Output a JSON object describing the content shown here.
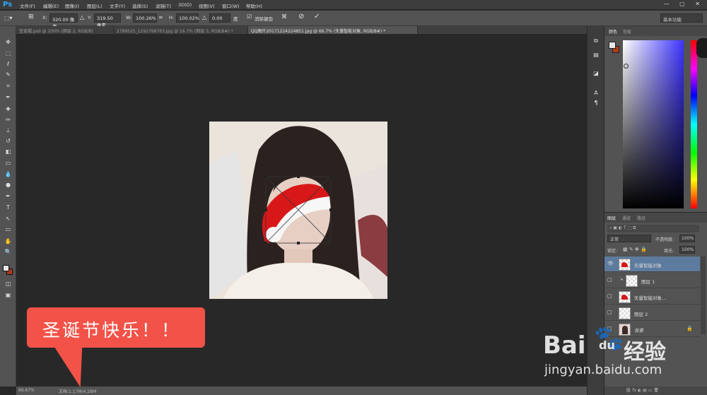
{
  "app": {
    "logo": "Ps",
    "window_controls": "— ▢ ✕"
  },
  "menu": [
    "文件(F)",
    "编辑(E)",
    "图像(I)",
    "图层(L)",
    "文字(Y)",
    "选择(S)",
    "滤镜(T)",
    "3D(D)",
    "视图(V)",
    "窗口(W)",
    "帮助(H)"
  ],
  "options": {
    "x_label": "X:",
    "x_value": "320.00 像素",
    "y_label": "Y:",
    "y_value": "319.50 像素",
    "w_label": "W:",
    "w_value": "100.26%",
    "h_label": "H:",
    "h_value": "100.02%",
    "angle_value": "0.00",
    "angle_unit": "度",
    "interp_label": "消除锯齿",
    "workspace": "基本功能"
  },
  "tabs": [
    "圣诞帽.psd @ 100% (图层 2, RGB/8)",
    "2789521_1291798763.jpg @ 16.7% (图层 3, RGB/8#) *",
    "QQ图片20171224224851.jpg @ 66.7% (矢量智能对象, RGB/8#) *"
  ],
  "status": {
    "zoom": "66.67%",
    "doc": "文档:1.17M/4.28M"
  },
  "color_panel": {
    "tabs": [
      "颜色",
      "色板"
    ]
  },
  "layers_panel": {
    "tabs": [
      "图层",
      "通道",
      "路径"
    ],
    "blend_mode": "正常",
    "opacity_label": "不透明度:",
    "opacity_value": "100%",
    "lock_label": "锁定:",
    "fill_label": "填充:",
    "fill_value": "100%",
    "layers": [
      {
        "name": "矢量智能对象"
      },
      {
        "name": "图层 1"
      },
      {
        "name": "矢量智能对象..."
      },
      {
        "name": "图层 2"
      },
      {
        "name": "背景"
      }
    ]
  },
  "callout": {
    "text": "圣诞节快乐！！"
  },
  "watermark": {
    "brand": "Bai",
    "brand2": "du",
    "product": "经验",
    "url": "jingyan.baidu.com"
  },
  "colors": {
    "foreground": "#e8e8e8",
    "background": "#b03a14",
    "hat_red": "#e01b1b",
    "callout": "#f25248"
  }
}
